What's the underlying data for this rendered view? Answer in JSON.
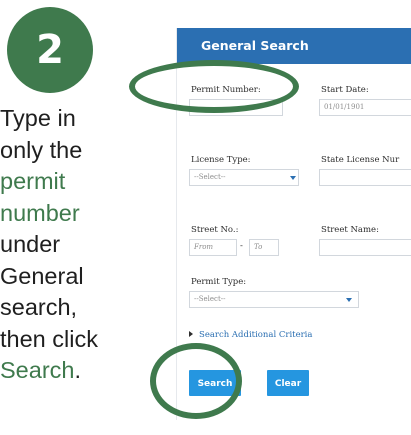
{
  "step": {
    "number": "2"
  },
  "instruction": {
    "l1": "Type in",
    "l2": "only the",
    "l3": "permit",
    "l4": "number",
    "l5": "under",
    "l6": "General",
    "l7": "search,",
    "l8": "then click",
    "l9_link": "Search",
    "l9_end": "."
  },
  "form": {
    "title": "General Search",
    "permit_number_label": "Permit Number:",
    "permit_number_value": "",
    "start_date_label": "Start Date:",
    "start_date_value": "01/01/1901",
    "license_type_label": "License Type:",
    "license_type_value": "--Select--",
    "state_license_label": "State License Nur",
    "state_license_value": "",
    "street_no_label": "Street No.:",
    "street_no_from": "From",
    "street_no_dash": "-",
    "street_no_to": "To",
    "street_name_label": "Street Name:",
    "street_name_value": "",
    "permit_type_label": "Permit Type:",
    "permit_type_value": "--Select--",
    "additional_link": "Search Additional Criteria",
    "search_button": "Search",
    "clear_button": "Clear"
  },
  "colors": {
    "accent_green": "#3f7a4d",
    "header_blue": "#2b6fb2",
    "button_blue": "#2596e0"
  }
}
